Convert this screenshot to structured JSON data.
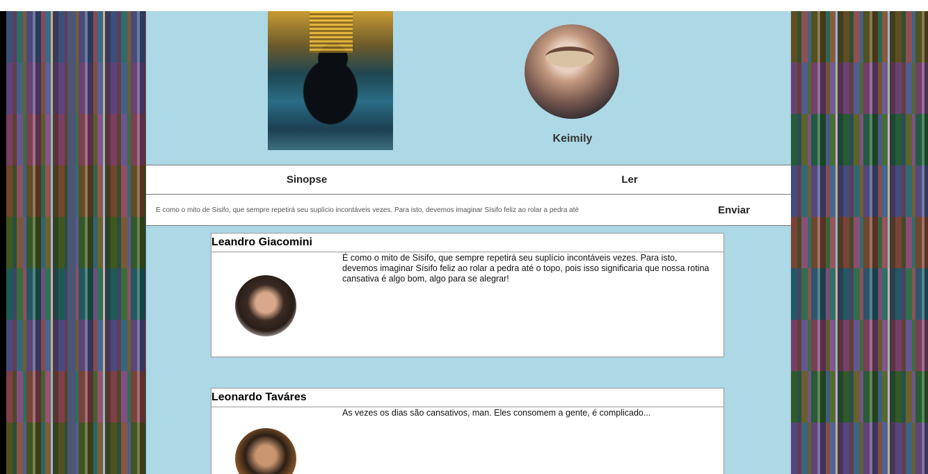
{
  "top_caption": "",
  "profile": {
    "name": "Keimily"
  },
  "tabs": [
    {
      "label": "Sinopse"
    },
    {
      "label": "Ler"
    }
  ],
  "comment_box": {
    "value": "É como o mito de Sisifo, que sempre repetirá seu suplício incontáveis vezes. Para isto, devemos imaginar Sísifo feliz ao rolar a pedra até",
    "send_label": "Enviar"
  },
  "comments": [
    {
      "author": "Leandro Giacomini",
      "text": "É como o mito de Sisifo, que sempre repetirá seu suplício incontáveis vezes. Para isto, devemos imaginar Sísifo feliz ao rolar a pedra até o topo, pois isso significaria que nossa rotina cansativa é algo bom, algo para se alegrar!"
    },
    {
      "author": "Leonardo Taváres",
      "text": "As vezes os dias são cansativos, man. Eles consomem a gente, é complicado..."
    }
  ],
  "colors": {
    "main_background": "#add8e6",
    "panel": "#ffffff",
    "border": "#777777"
  }
}
